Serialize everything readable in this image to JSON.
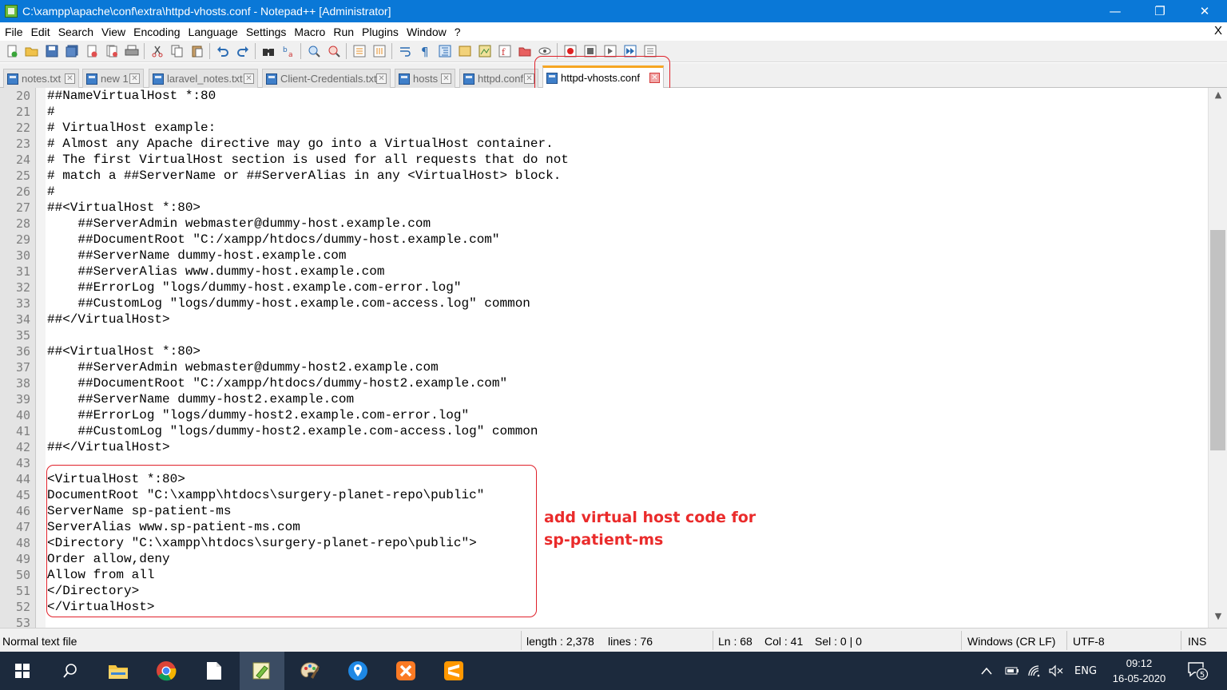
{
  "window": {
    "title": "C:\\xampp\\apache\\conf\\extra\\httpd-vhosts.conf - Notepad++ [Administrator]",
    "controls": {
      "minimize": "—",
      "maximize": "❐",
      "close": "✕"
    }
  },
  "menu": {
    "items": [
      "File",
      "Edit",
      "Search",
      "View",
      "Encoding",
      "Language",
      "Settings",
      "Macro",
      "Run",
      "Plugins",
      "Window",
      "?"
    ],
    "close_label": "X"
  },
  "tabs": [
    {
      "label": "notes.txt",
      "active": false
    },
    {
      "label": "new 1",
      "active": false
    },
    {
      "label": "laravel_notes.txt",
      "active": false
    },
    {
      "label": "Client-Credentials.txt",
      "active": false
    },
    {
      "label": "hosts",
      "active": false
    },
    {
      "label": "httpd.conf",
      "active": false
    },
    {
      "label": "httpd-vhosts.conf",
      "active": true
    }
  ],
  "tab_close_glyph": "✕",
  "editor": {
    "lines": [
      {
        "n": "20",
        "text": "##NameVirtualHost *:80"
      },
      {
        "n": "21",
        "text": "#"
      },
      {
        "n": "22",
        "text": "# VirtualHost example:"
      },
      {
        "n": "23",
        "text": "# Almost any Apache directive may go into a VirtualHost container."
      },
      {
        "n": "24",
        "text": "# The first VirtualHost section is used for all requests that do not"
      },
      {
        "n": "25",
        "text": "# match a ##ServerName or ##ServerAlias in any <VirtualHost> block."
      },
      {
        "n": "26",
        "text": "#"
      },
      {
        "n": "27",
        "text": "##<VirtualHost *:80>"
      },
      {
        "n": "28",
        "text": "    ##ServerAdmin webmaster@dummy-host.example.com"
      },
      {
        "n": "29",
        "text": "    ##DocumentRoot \"C:/xampp/htdocs/dummy-host.example.com\""
      },
      {
        "n": "30",
        "text": "    ##ServerName dummy-host.example.com"
      },
      {
        "n": "31",
        "text": "    ##ServerAlias www.dummy-host.example.com"
      },
      {
        "n": "32",
        "text": "    ##ErrorLog \"logs/dummy-host.example.com-error.log\""
      },
      {
        "n": "33",
        "text": "    ##CustomLog \"logs/dummy-host.example.com-access.log\" common"
      },
      {
        "n": "34",
        "text": "##</VirtualHost>"
      },
      {
        "n": "35",
        "text": ""
      },
      {
        "n": "36",
        "text": "##<VirtualHost *:80>"
      },
      {
        "n": "37",
        "text": "    ##ServerAdmin webmaster@dummy-host2.example.com"
      },
      {
        "n": "38",
        "text": "    ##DocumentRoot \"C:/xampp/htdocs/dummy-host2.example.com\""
      },
      {
        "n": "39",
        "text": "    ##ServerName dummy-host2.example.com"
      },
      {
        "n": "40",
        "text": "    ##ErrorLog \"logs/dummy-host2.example.com-error.log\""
      },
      {
        "n": "41",
        "text": "    ##CustomLog \"logs/dummy-host2.example.com-access.log\" common"
      },
      {
        "n": "42",
        "text": "##</VirtualHost>"
      },
      {
        "n": "43",
        "text": ""
      },
      {
        "n": "44",
        "text": "<VirtualHost *:80>"
      },
      {
        "n": "45",
        "text": "DocumentRoot \"C:\\xampp\\htdocs\\surgery-planet-repo\\public\""
      },
      {
        "n": "46",
        "text": "ServerName sp-patient-ms"
      },
      {
        "n": "47",
        "text": "ServerAlias www.sp-patient-ms.com"
      },
      {
        "n": "48",
        "text": "<Directory \"C:\\xampp\\htdocs\\surgery-planet-repo\\public\">"
      },
      {
        "n": "49",
        "text": "Order allow,deny"
      },
      {
        "n": "50",
        "text": "Allow from all"
      },
      {
        "n": "51",
        "text": "</Directory>"
      },
      {
        "n": "52",
        "text": "</VirtualHost>"
      },
      {
        "n": "53",
        "text": ""
      }
    ],
    "annotation": [
      "add virtual host code for",
      "sp-patient-ms"
    ]
  },
  "scrollbar": {
    "up": "▲",
    "down": "▼"
  },
  "status": {
    "file_type": "Normal text file",
    "length": "length : 2,378",
    "lines": "lines : 76",
    "ln": "Ln : 68",
    "col": "Col : 41",
    "sel": "Sel : 0 | 0",
    "eol": "Windows (CR LF)",
    "encoding": "UTF-8",
    "mode": "INS"
  },
  "taskbar": {
    "language": "ENG",
    "time": "09:12",
    "date": "16-05-2020",
    "notifications": "5"
  },
  "colors": {
    "titlebar": "#0a78d7",
    "annotation": "#ea2b2b",
    "taskbar": "#1c2a3d"
  }
}
